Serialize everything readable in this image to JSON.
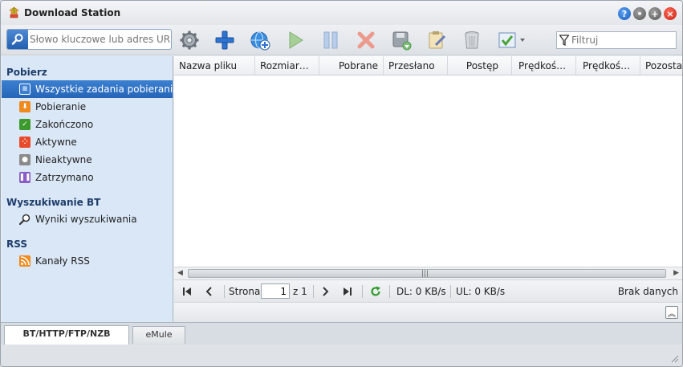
{
  "window": {
    "title": "Download Station"
  },
  "toolbar": {
    "search_placeholder": "Słowo kluczowe lub adres URL",
    "filter_placeholder": "Filtruj"
  },
  "sidebar": {
    "sections": [
      {
        "title": "Pobierz",
        "items": [
          {
            "label": "Wszystkie zadania pobierania",
            "icon": "list-icon",
            "color": "#3c7fd1",
            "selected": true
          },
          {
            "label": "Pobieranie",
            "icon": "download-arrow-icon",
            "color": "#f08a1c"
          },
          {
            "label": "Zakończono",
            "icon": "check-icon",
            "color": "#3c9a2c"
          },
          {
            "label": "Aktywne",
            "icon": "active-dots-icon",
            "color": "#e84a2c"
          },
          {
            "label": "Nieaktywne",
            "icon": "inactive-icon",
            "color": "#8a8a8a"
          },
          {
            "label": "Zatrzymano",
            "icon": "pause-icon",
            "color": "#8a5cc8"
          }
        ]
      },
      {
        "title": "Wyszukiwanie BT",
        "items": [
          {
            "label": "Wyniki wyszukiwania",
            "icon": "magnifier-icon"
          }
        ]
      },
      {
        "title": "RSS",
        "items": [
          {
            "label": "Kanały RSS",
            "icon": "rss-icon",
            "color": "#f28a1e"
          }
        ]
      }
    ]
  },
  "grid": {
    "columns": [
      "Nazwa pliku",
      "Rozmiar…",
      "Pobrane",
      "Przesłano",
      "Postęp",
      "Prędkoś…",
      "Prędkoś…",
      "Pozosta"
    ]
  },
  "pager": {
    "page_label": "Strona",
    "page_value": "1",
    "of_label": "z 1",
    "dl_status": "DL: 0 KB/s",
    "ul_status": "UL: 0 KB/s",
    "empty_text": "Brak danych"
  },
  "tabs": [
    "BT/HTTP/FTP/NZB",
    "eMule"
  ]
}
